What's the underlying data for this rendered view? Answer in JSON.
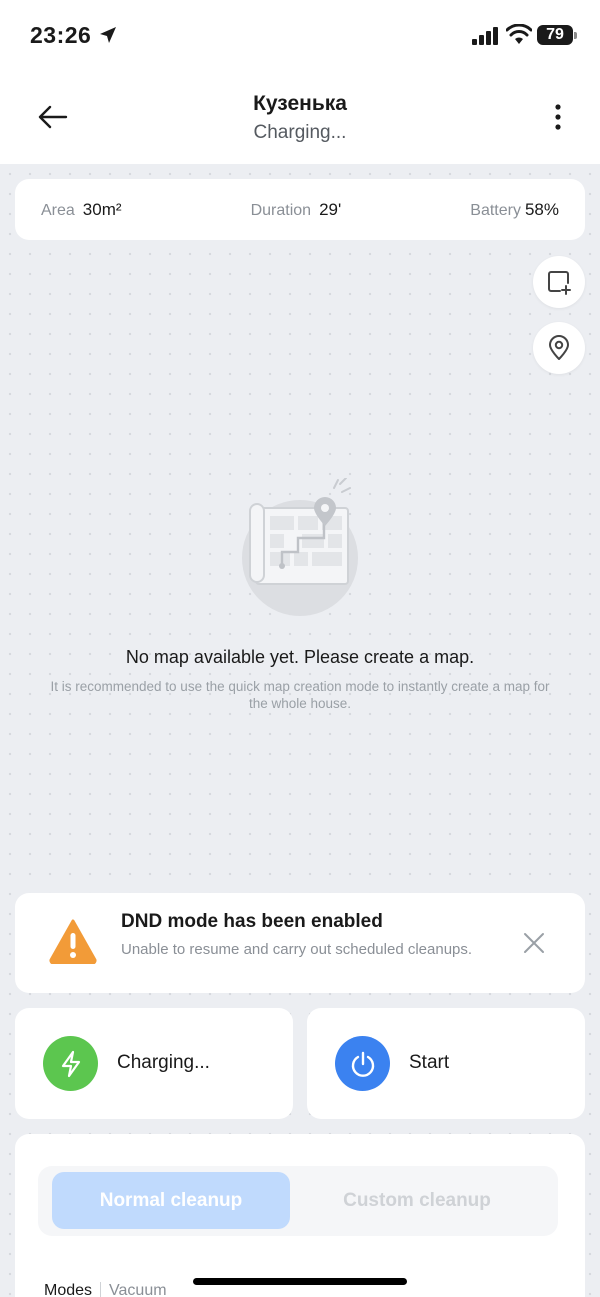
{
  "status_bar": {
    "time": "23:26",
    "battery": "79",
    "icons": [
      "location-arrow-icon",
      "signal-icon",
      "wifi-icon",
      "battery-icon"
    ]
  },
  "header": {
    "title": "Кузенька",
    "subtitle": "Charging..."
  },
  "stats": {
    "area_label": "Area",
    "area_value": "30m²",
    "duration_label": "Duration",
    "duration_value": "29'",
    "battery_label": "Battery",
    "battery_value": "58%"
  },
  "map": {
    "empty_title": "No map available yet. Please create a map.",
    "empty_desc": "It is recommended to use the quick map creation mode to instantly create a map for the whole house."
  },
  "dnd": {
    "title": "DND mode has been enabled",
    "description": "Unable to resume and carry out scheduled cleanups."
  },
  "actions": {
    "charging_label": "Charging...",
    "start_label": "Start"
  },
  "mode_tabs": {
    "normal": "Normal cleanup",
    "custom": "Custom cleanup"
  },
  "modes": {
    "label": "Modes",
    "value": "Vacuum"
  },
  "colors": {
    "accent_blue": "#3b82f0",
    "charging_green": "#5cc64f",
    "warning_orange": "#f29b38",
    "active_tab": "#c0dafd"
  }
}
